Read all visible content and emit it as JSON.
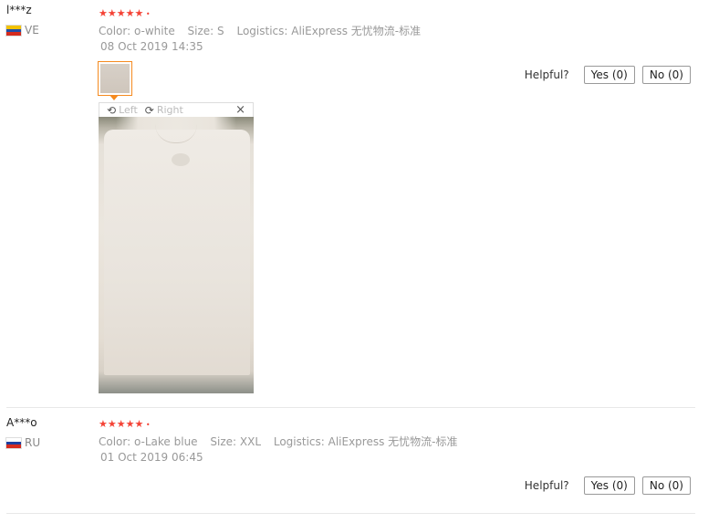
{
  "reviews": [
    {
      "username": "l***z",
      "country": "VE",
      "flag_colors": [
        "#f2c200",
        "#1f4fa8",
        "#d52b1e"
      ],
      "stars": "★★★★★",
      "color_label": "Color: o-white",
      "size_label": "Size: S",
      "logistics_label": "Logistics: AliExpress 无忧物流-标准",
      "date": "08 Oct 2019 14:35",
      "helpful_label": "Helpful?",
      "yes_label": "Yes (0)",
      "no_label": "No (0)",
      "viewer": {
        "left_label": "Left",
        "right_label": "Right",
        "close": "×"
      }
    },
    {
      "username": "A***o",
      "country": "RU",
      "flag_colors": [
        "#ffffff",
        "#1c3fa0",
        "#d52b1e"
      ],
      "stars": "★★★★★",
      "color_label": "Color: o-Lake blue",
      "size_label": "Size: XXL",
      "logistics_label": "Logistics: AliExpress 无忧物流-标准",
      "date": "01 Oct 2019 06:45",
      "helpful_label": "Helpful?",
      "yes_label": "Yes (0)",
      "no_label": "No (0)"
    }
  ],
  "accent_color": "#f44336",
  "highlight_color": "#f58a1f"
}
